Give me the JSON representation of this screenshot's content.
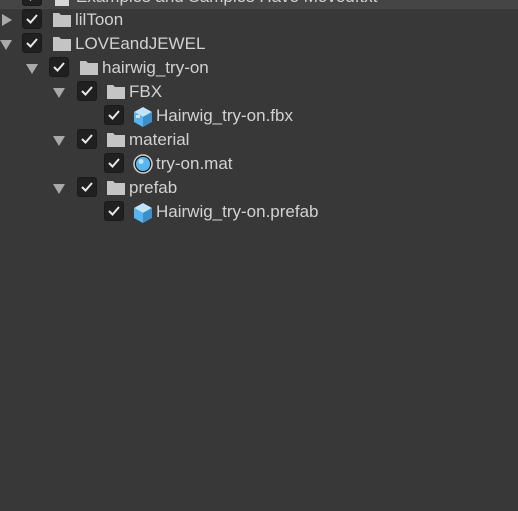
{
  "tree": {
    "items": [
      {
        "label": "Examples and Samples Have Moved.txt",
        "icon": "text-file-icon",
        "state": "none",
        "checked": true
      },
      {
        "label": "lilToon",
        "icon": "folder-icon",
        "state": "collapsed",
        "checked": true
      },
      {
        "label": "LOVEandJEWEL",
        "icon": "folder-icon",
        "state": "expanded",
        "checked": true
      },
      {
        "label": "hairwig_try-on",
        "icon": "folder-icon",
        "state": "expanded",
        "checked": true
      },
      {
        "label": "FBX",
        "icon": "folder-icon",
        "state": "expanded",
        "checked": true
      },
      {
        "label": "Hairwig_try-on.fbx",
        "icon": "model-cube-icon",
        "state": "none",
        "checked": true
      },
      {
        "label": "material",
        "icon": "folder-icon",
        "state": "expanded",
        "checked": true
      },
      {
        "label": "try-on.mat",
        "icon": "material-sphere-icon",
        "state": "none",
        "checked": true
      },
      {
        "label": "prefab",
        "icon": "folder-icon",
        "state": "expanded",
        "checked": true
      },
      {
        "label": "Hairwig_try-on.prefab",
        "icon": "prefab-cube-icon",
        "state": "none",
        "checked": true
      }
    ]
  },
  "colors": {
    "background": "#383838",
    "text": "#d2d2d2",
    "icon_blue": "#57b6f0"
  }
}
